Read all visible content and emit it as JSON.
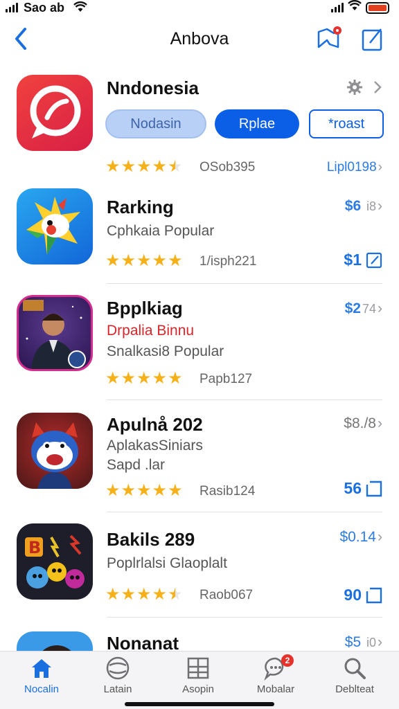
{
  "status_bar": {
    "carrier": "Sao ab",
    "time": "",
    "battery_color": "#e1401f"
  },
  "nav": {
    "title": "Anbova",
    "back_icon": "chevron-left-icon",
    "bookmark_icon": "bookmark-icon",
    "compose_icon": "compose-icon"
  },
  "featured": {
    "name": "Nndonesia",
    "buttons": [
      "Nodasin",
      "Rplae",
      "*roast"
    ],
    "rating": 4.5,
    "meta": "OSob395",
    "link": "Lipl0198"
  },
  "apps": [
    {
      "name": "Rarking",
      "subtitle": "Cphkaia Popular",
      "rating": 5,
      "meta": "1/isph221",
      "price_top": "$6",
      "price_top_suffix": "i8",
      "action": "$1"
    },
    {
      "name": "Bpplkiag",
      "subtitle_red": "Drpalia Binnu",
      "subtitle": "Snalkasi8 Popular",
      "rating": 5,
      "meta": "Papb127",
      "price_top": "$2",
      "price_top_suffix": "74"
    },
    {
      "name": "Apulnå 202",
      "subtitle": "AplakasSiniars",
      "subtitle2": "Sapd .lar",
      "rating": 5,
      "meta": "Rasib124",
      "price_top": "$8./8",
      "action": "56"
    },
    {
      "name": "Bakils 289",
      "subtitle": "Poplrlalsi Glaoplalt",
      "rating": 4.5,
      "meta": "Raob067",
      "price_top": "$0.14",
      "action": "90"
    },
    {
      "name": "Nonanat",
      "price_top": "$5",
      "price_top_suffix": "i0"
    }
  ],
  "tabs": [
    {
      "label": "Nocalin",
      "icon": "home-icon",
      "active": true
    },
    {
      "label": "Latain",
      "icon": "globe-icon",
      "active": false
    },
    {
      "label": "Asopin",
      "icon": "grid-icon",
      "active": false
    },
    {
      "label": "Mobalar",
      "icon": "chat-icon",
      "active": false,
      "badge": "2"
    },
    {
      "label": "Deblteat",
      "icon": "search-icon",
      "active": false
    }
  ],
  "colors": {
    "accent": "#1a6fe0",
    "star": "#f6b118",
    "badge": "#e5322c"
  }
}
